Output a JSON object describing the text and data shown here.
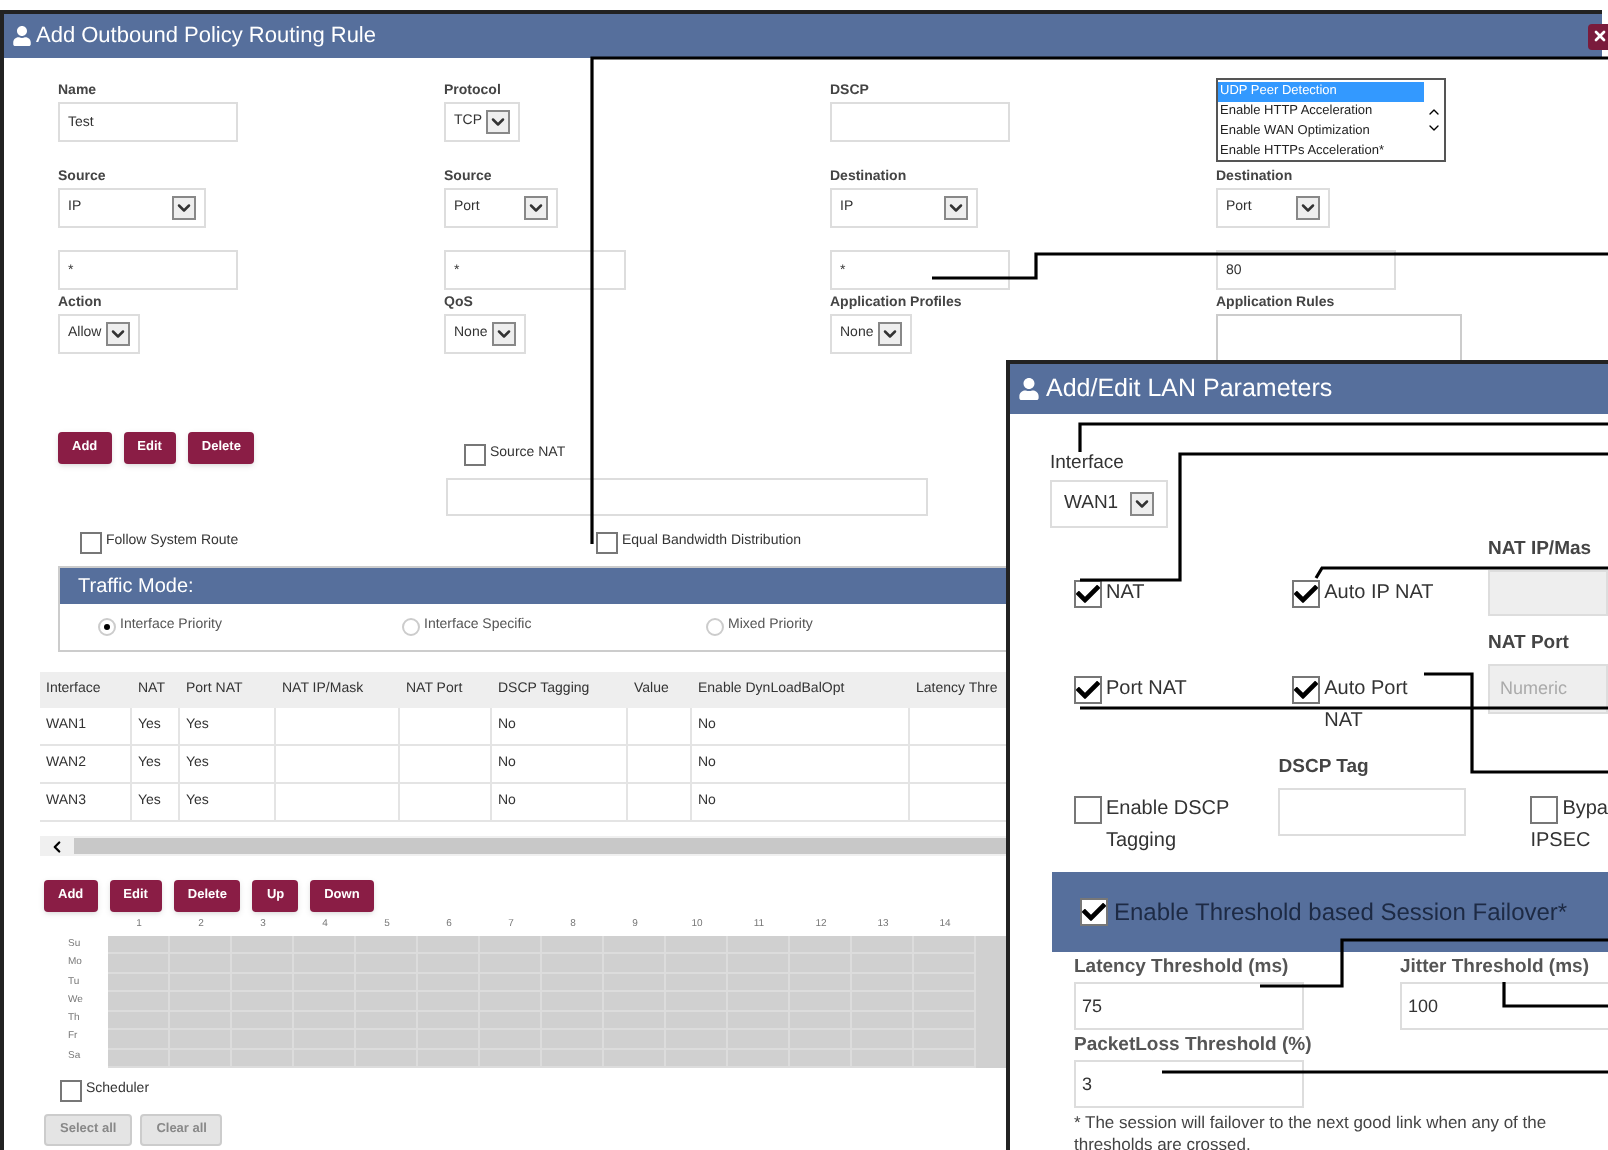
{
  "main_dialog": {
    "title": "Add Outbound Policy Routing Rule",
    "field_rows": [
      [
        {
          "kind": "text",
          "label": "Name",
          "value": "Test"
        },
        {
          "kind": "select",
          "label": "Protocol",
          "value": "TCP"
        },
        {
          "kind": "text",
          "label": "DSCP"
        },
        {
          "kind": "listbox",
          "options": [
            {
              "text": "UDP Peer Detection",
              "selected": true
            },
            {
              "text": "Enable HTTP Acceleration",
              "selected": false
            },
            {
              "text": "Enable WAN Optimization",
              "selected": false
            },
            {
              "text": "Enable HTTPs Acceleration*",
              "selected": false
            }
          ]
        }
      ],
      [
        {
          "kind": "select",
          "label": "Source",
          "value": "IP"
        },
        {
          "kind": "select",
          "label": "Source",
          "value": "Port"
        },
        {
          "kind": "select",
          "label": "Destination",
          "value": "IP"
        },
        {
          "kind": "select",
          "label": "Destination",
          "value": "Port"
        }
      ],
      [
        {
          "kind": "text",
          "value": "*"
        },
        {
          "kind": "text",
          "value": "*"
        },
        {
          "kind": "text",
          "value": "*"
        },
        {
          "kind": "text",
          "value": "80"
        }
      ],
      [
        {
          "kind": "select",
          "label": "Action",
          "value": "Allow"
        },
        {
          "kind": "select",
          "label": "QoS",
          "value": "None"
        },
        {
          "kind": "select",
          "label": "Application Profiles",
          "value": "None"
        },
        {
          "kind": "textarea",
          "label": "Application Rules"
        }
      ]
    ],
    "rule_buttons": [
      {
        "label": "Add",
        "disabled": false
      },
      {
        "label": "Edit",
        "disabled": false
      },
      {
        "label": "Delete",
        "disabled": false
      }
    ],
    "source_nat": {
      "label": "Source NAT",
      "checked": false
    },
    "follow_system_route": {
      "label": "Follow System Route",
      "checked": false
    },
    "equal_bandwidth": {
      "label": "Equal Bandwidth Distribution",
      "checked": false
    },
    "traffic_mode": {
      "title": "Traffic Mode:",
      "options": [
        {
          "label": "Interface Priority",
          "selected": true
        },
        {
          "label": "Interface Specific",
          "selected": false
        },
        {
          "label": "Mixed Priority",
          "selected": false
        }
      ]
    },
    "table": {
      "columns": [
        "Interface",
        "NAT",
        "Port NAT",
        "NAT IP/Mask",
        "NAT Port",
        "DSCP Tagging",
        "Value",
        "Enable DynLoadBalOpt",
        "Latency Thre"
      ],
      "rows": [
        [
          "WAN1",
          "Yes",
          "Yes",
          "",
          "",
          "No",
          "",
          "No",
          ""
        ],
        [
          "WAN2",
          "Yes",
          "Yes",
          "",
          "",
          "No",
          "",
          "No",
          ""
        ],
        [
          "WAN3",
          "Yes",
          "Yes",
          "",
          "",
          "No",
          "",
          "No",
          ""
        ]
      ]
    },
    "table_buttons": [
      {
        "label": "Add",
        "disabled": false
      },
      {
        "label": "Edit",
        "disabled": false
      },
      {
        "label": "Delete",
        "disabled": false
      },
      {
        "label": "Up",
        "disabled": false
      },
      {
        "label": "Down",
        "disabled": false
      }
    ],
    "schedule": {
      "hours": [
        "1",
        "2",
        "3",
        "4",
        "5",
        "6",
        "7",
        "8",
        "9",
        "10",
        "11",
        "12",
        "13",
        "14"
      ],
      "days": [
        "Su",
        "Mo",
        "Tu",
        "We",
        "Th",
        "Fr",
        "Sa"
      ]
    },
    "scheduler": {
      "label": "Scheduler",
      "checked": false
    },
    "schedule_buttons": [
      {
        "label": "Select all",
        "disabled": true
      },
      {
        "label": "Clear all",
        "disabled": true
      }
    ]
  },
  "lan_dialog": {
    "title": "Add/Edit LAN Parameters",
    "interface": {
      "label": "Interface",
      "value": "WAN1"
    },
    "nat": {
      "label": "NAT",
      "checked": true
    },
    "auto_ip_nat": {
      "label": "Auto IP NAT",
      "checked": true
    },
    "nat_ip_mask": {
      "label": "NAT IP/Mas",
      "disabled": true
    },
    "port_nat": {
      "label": "Port NAT",
      "checked": true
    },
    "auto_port_nat": {
      "label": "Auto Port NAT",
      "checked": true
    },
    "nat_port": {
      "label": "NAT Port",
      "placeholder": "Numeric",
      "disabled": true
    },
    "dscp_tagging": {
      "label": "Enable DSCP Tagging",
      "checked": false
    },
    "dscp_tag": {
      "label": "DSCP Tag"
    },
    "bypass": {
      "label": "Bypa",
      "label_line_2": "IPSEC",
      "checked": false
    },
    "threshold": {
      "label": "Enable Threshold based Session Failover*",
      "checked": true
    },
    "thresholds": [
      {
        "label": "Latency Threshold (ms)",
        "value": "75"
      },
      {
        "label": "Jitter Threshold (ms)",
        "value": "100"
      },
      {
        "label": "PacketLoss Threshold (%)",
        "value": "3"
      }
    ],
    "note": "* The session will failover to the next good link when any of the thresholds are crossed."
  }
}
